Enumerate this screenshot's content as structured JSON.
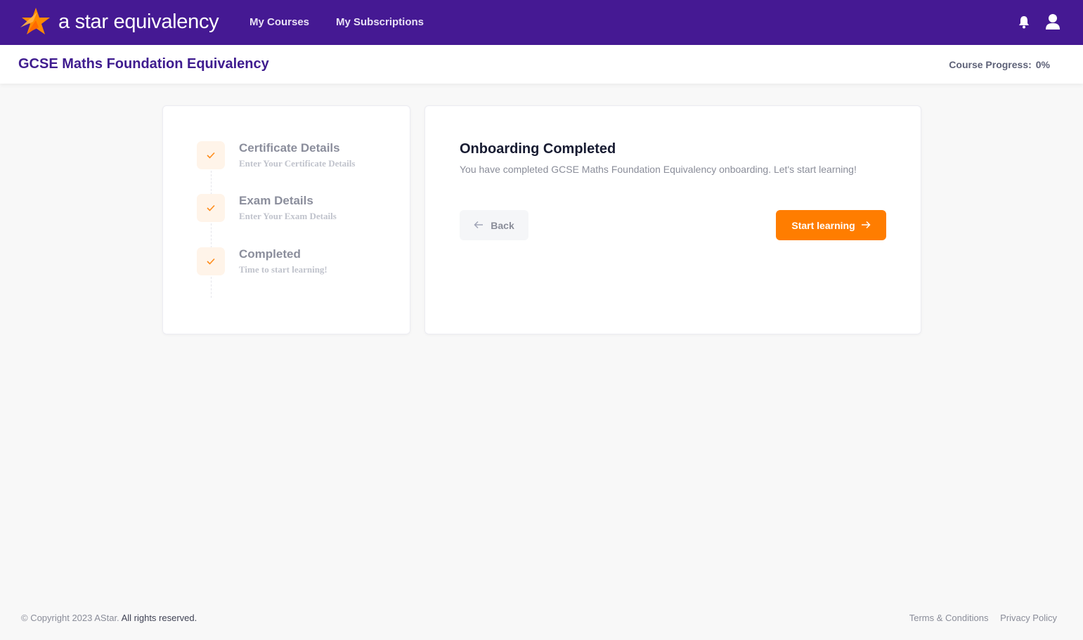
{
  "colors": {
    "brand_purple": "#451993",
    "accent_orange": "#ff7d00",
    "page_background": "#f8f8f8"
  },
  "topbar": {
    "logo_text": "a star equivalency",
    "nav": [
      {
        "label": "My Courses"
      },
      {
        "label": "My Subscriptions"
      }
    ],
    "icons": [
      "bell-icon",
      "user-icon"
    ]
  },
  "subheader": {
    "course_title": "GCSE Maths Foundation Equivalency",
    "progress_label": "Course Progress:",
    "progress_value": "0%"
  },
  "steps": [
    {
      "title": "Certificate Details",
      "description": "Enter Your Certificate Details",
      "status": "completed",
      "icon": "check-icon"
    },
    {
      "title": "Exam Details",
      "description": "Enter Your Exam Details",
      "status": "completed",
      "icon": "check-icon"
    },
    {
      "title": "Completed",
      "description": "Time to start learning!",
      "status": "completed",
      "icon": "check-icon"
    }
  ],
  "main": {
    "title": "Onboarding Completed",
    "message": "You have completed GCSE Maths Foundation Equivalency onboarding. Let's start learning!",
    "back_label": "Back",
    "start_label": "Start learning"
  },
  "footer": {
    "copyright": "© Copyright 2023 AStar.",
    "rights": "All rights reserved.",
    "links": [
      "Terms & Conditions",
      "Privacy Policy"
    ]
  }
}
